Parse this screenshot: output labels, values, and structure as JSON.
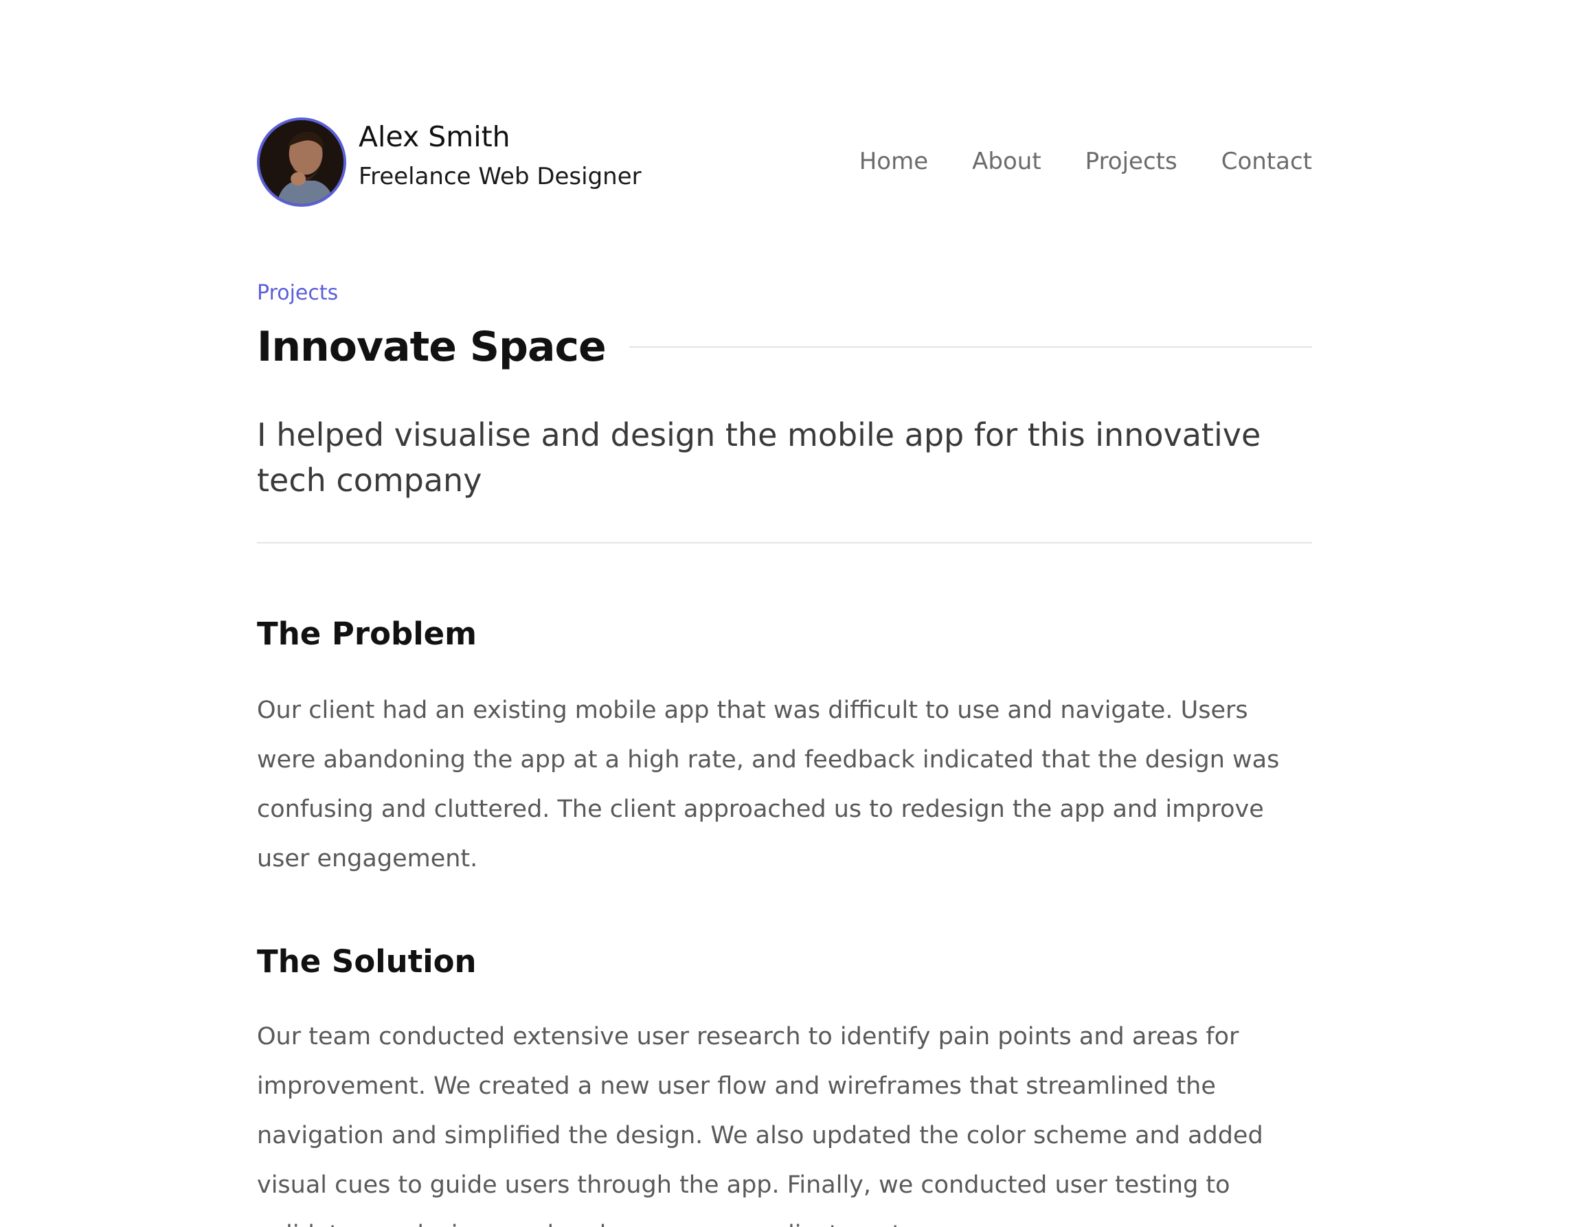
{
  "header": {
    "name": "Alex Smith",
    "role": "Freelance Web Designer",
    "avatar_icon": "portrait-photo",
    "nav": [
      {
        "label": "Home"
      },
      {
        "label": "About"
      },
      {
        "label": "Projects"
      },
      {
        "label": "Contact"
      }
    ]
  },
  "project": {
    "breadcrumb": "Projects",
    "title": "Innovate Space",
    "lead": "I helped visualise and design the mobile app for this innovative tech company"
  },
  "sections": [
    {
      "heading": "The Problem",
      "body": "Our client had an existing mobile app that was difficult to use and navigate. Users were abandoning the app at a high rate, and feedback indicated that the design was confusing and cluttered. The client approached us to redesign the app and improve user engagement."
    },
    {
      "heading": "The Solution",
      "body": "Our team conducted extensive user research to identify pain points and areas for improvement. We created a new user flow and wireframes that streamlined the navigation and simplified the design. We also updated the color scheme and added visual cues to guide users through the app. Finally, we conducted user testing to validate our designs and make necessary adjustments."
    }
  ],
  "colors": {
    "accent": "#5b5fd9",
    "heading": "#111111",
    "body": "#595959",
    "nav": "#6b6b6b",
    "rule": "#e4e4e4"
  }
}
